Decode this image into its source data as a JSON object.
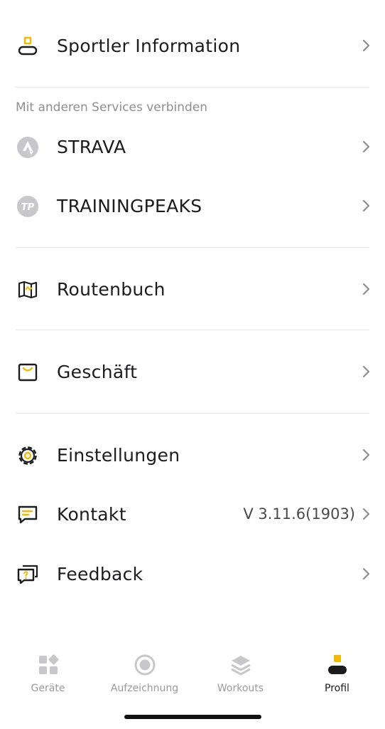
{
  "menu": {
    "athlete_info": "Sportler Information",
    "connect_section_title": "Mit anderen Services verbinden",
    "strava": "STRAVA",
    "trainingpeaks": "TRAININGPEAKS",
    "trainingpeaks_badge": "TP",
    "route_book": "Routenbuch",
    "shop": "Geschäft",
    "settings": "Einstellungen",
    "contact": "Kontakt",
    "version": "V 3.11.6(1903)",
    "feedback": "Feedback"
  },
  "tabs": [
    {
      "label": "Geräte",
      "icon": "grid-icon"
    },
    {
      "label": "Aufzeichnung",
      "icon": "record-icon"
    },
    {
      "label": "Workouts",
      "icon": "layers-icon"
    },
    {
      "label": "Profil",
      "icon": "profile-icon",
      "active": true
    }
  ],
  "colors": {
    "accent": "#f5b800",
    "text": "#1c1c1e",
    "muted": "#9a9a9e"
  }
}
